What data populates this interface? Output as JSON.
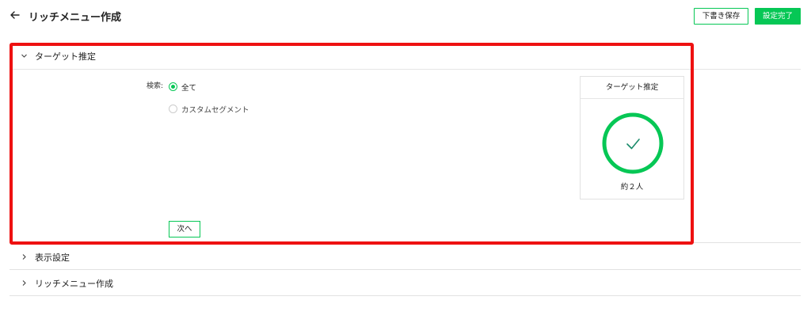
{
  "header": {
    "title": "リッチメニュー作成",
    "back_icon": "arrow-left-icon",
    "draft_button": "下書き保存",
    "done_button": "設定完了"
  },
  "colors": {
    "accent": "#06c755",
    "highlight": "#ee1111",
    "border": "#e2e2e2"
  },
  "sections": {
    "target": {
      "label": "ターゲット推定",
      "expanded": true,
      "search_label": "検索:",
      "options": [
        {
          "label": "全て",
          "selected": true
        },
        {
          "label": "カスタムセグメント",
          "selected": false
        }
      ],
      "next_button": "次へ",
      "card": {
        "title": "ターゲット推定",
        "count": "約２人",
        "icon": "check-circle-icon"
      }
    },
    "display": {
      "label": "表示設定",
      "expanded": false
    },
    "rich_menu": {
      "label": "リッチメニュー作成",
      "expanded": false
    }
  }
}
